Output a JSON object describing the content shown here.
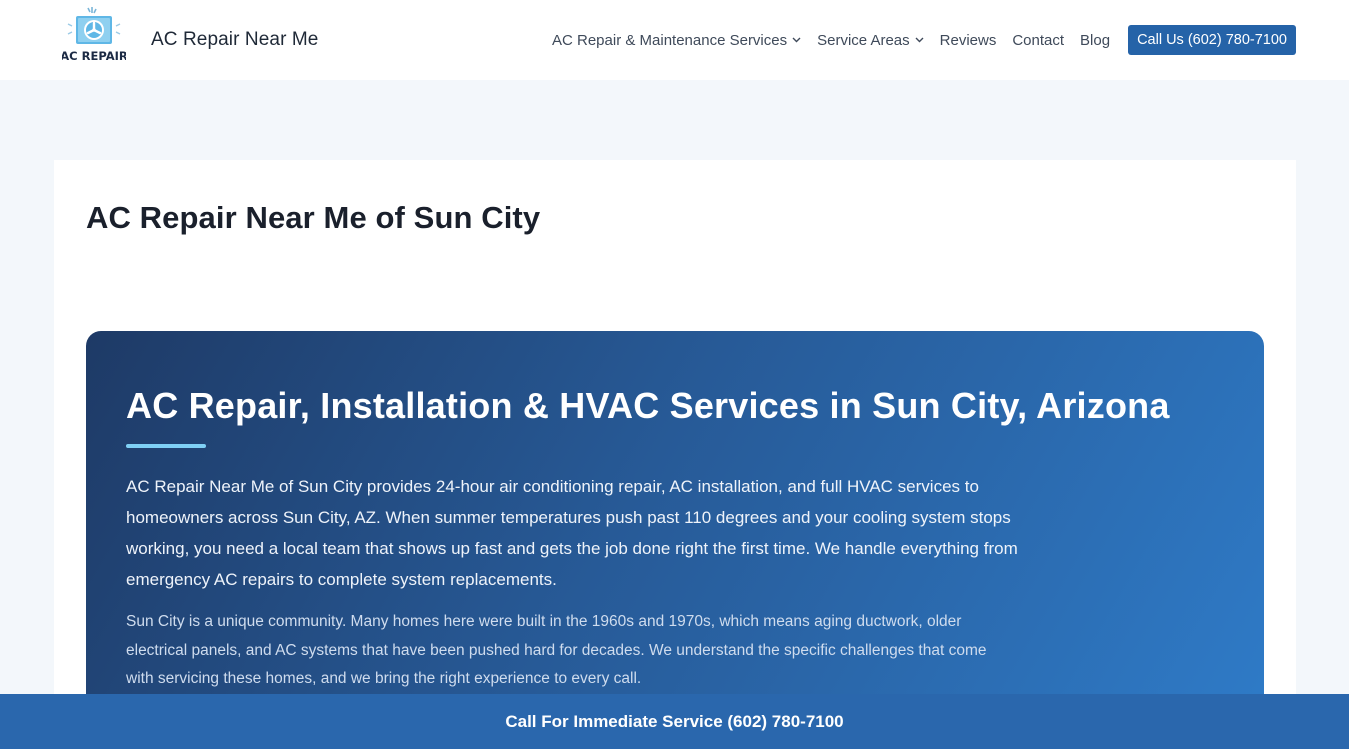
{
  "header": {
    "logo_text": "AC REPAIR",
    "site_title": "AC Repair Near Me",
    "nav": [
      {
        "label": "AC Repair & Maintenance Services",
        "has_dropdown": true
      },
      {
        "label": "Service Areas",
        "has_dropdown": true
      },
      {
        "label": "Reviews",
        "has_dropdown": false
      },
      {
        "label": "Contact",
        "has_dropdown": false
      },
      {
        "label": "Blog",
        "has_dropdown": false
      }
    ],
    "cta_label": "Call Us (602) 780-7100"
  },
  "main": {
    "page_title": "AC Repair Near Me of Sun City",
    "hero": {
      "title": "AC Repair, Installation & HVAC Services in Sun City, Arizona",
      "paragraph_1": "AC Repair Near Me of Sun City provides 24-hour air conditioning repair, AC installation, and full HVAC services to homeowners across Sun City, AZ. When summer temperatures push past 110 degrees and your cooling system stops working, you need a local team that shows up fast and gets the job done right the first time. We handle everything from emergency AC repairs to complete system replacements.",
      "paragraph_2": "Sun City is a unique community. Many homes here were built in the 1960s and 1970s, which means aging ductwork, older electrical panels, and AC systems that have been pushed hard for decades. We understand the specific challenges that come with servicing these homes, and we bring the right experience to every call."
    }
  },
  "bottom_bar": {
    "label": "Call For Immediate Service (602) 780-7100"
  },
  "colors": {
    "brand_blue": "#2563a8",
    "hero_gradient_start": "#1e3a66",
    "hero_gradient_end": "#2f7cc9",
    "accent_underline": "#7fd0f5"
  },
  "icons": [
    "ac-unit-logo-icon",
    "chevron-down-icon"
  ]
}
